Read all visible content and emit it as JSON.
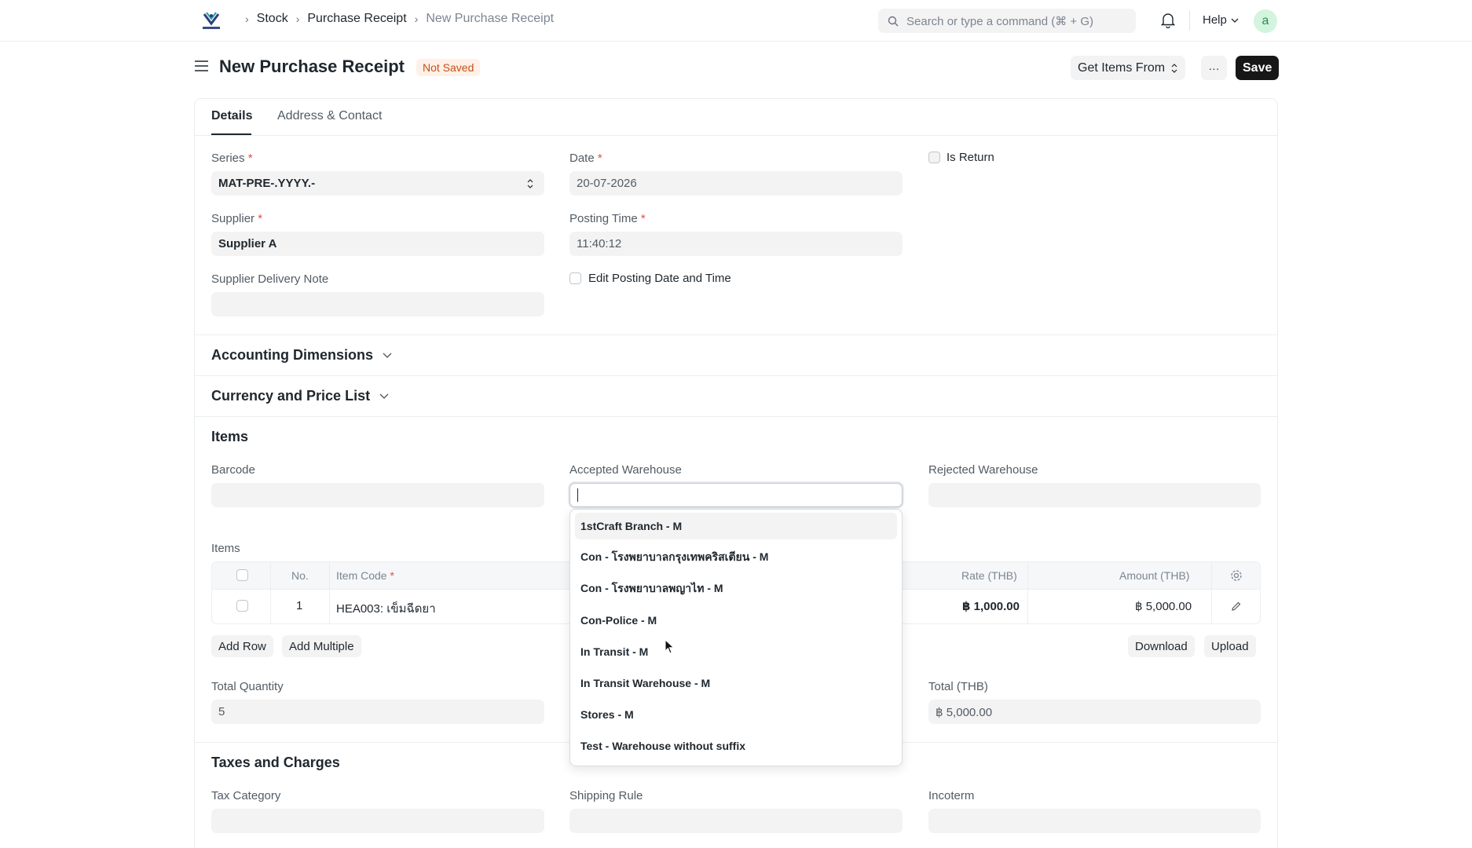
{
  "navbar": {
    "breadcrumbs": [
      "Stock",
      "Purchase Receipt",
      "New Purchase Receipt"
    ],
    "search_placeholder": "Search or type a command (⌘ + G)",
    "help_label": "Help",
    "avatar_letter": "a"
  },
  "page": {
    "title": "New Purchase Receipt",
    "status_badge": "Not Saved",
    "get_items_label": "Get Items From",
    "more_label": "···",
    "save_label": "Save"
  },
  "tabs": [
    "Details",
    "Address & Contact"
  ],
  "details": {
    "series_label": "Series",
    "series_value": "MAT-PRE-.YYYY.-",
    "date_label": "Date",
    "date_value": "20-07-2026",
    "is_return_label": "Is Return",
    "supplier_label": "Supplier",
    "supplier_value": "Supplier A",
    "posting_time_label": "Posting Time",
    "posting_time_value": "11:40:12",
    "supplier_delivery_note_label": "Supplier Delivery Note",
    "edit_posting_label": "Edit Posting Date and Time"
  },
  "sections": {
    "accounting_dimensions": "Accounting Dimensions",
    "currency_price_list": "Currency and Price List",
    "items": "Items",
    "taxes_charges": "Taxes and Charges"
  },
  "items_section": {
    "barcode_label": "Barcode",
    "accepted_warehouse_label": "Accepted Warehouse",
    "rejected_warehouse_label": "Rejected Warehouse",
    "table_label": "Items",
    "columns": {
      "no": "No.",
      "item_code": "Item Code",
      "rate": "Rate (THB)",
      "amount": "Amount (THB)"
    },
    "rows": [
      {
        "no": "1",
        "item_code": "HEA003: เข็มฉีดยา",
        "rate": "฿ 1,000.00",
        "amount": "฿ 5,000.00"
      }
    ],
    "add_row_label": "Add Row",
    "add_multiple_label": "Add Multiple",
    "download_label": "Download",
    "upload_label": "Upload",
    "total_quantity_label": "Total Quantity",
    "total_quantity_value": "5",
    "total_label": "Total (THB)",
    "total_value": "฿ 5,000.00"
  },
  "taxes": {
    "tax_category_label": "Tax Category",
    "shipping_rule_label": "Shipping Rule",
    "incoterm_label": "Incoterm"
  },
  "warehouse_dropdown": [
    "1stCraft Branch - M",
    "Con - โรงพยาบาลกรุงเทพคริสเตียน - M",
    "Con - โรงพยาบาลพญาไท - M",
    "Con-Police - M",
    "In Transit - M",
    "In Transit Warehouse - M",
    "Stores - M",
    "Test - Warehouse without suffix"
  ],
  "colors": {
    "primary_button": "#171717",
    "badge_bg": "#fff1e7",
    "badge_text": "#c4501b",
    "required_mark": "#e24c4c",
    "input_bg": "#f3f3f3"
  }
}
